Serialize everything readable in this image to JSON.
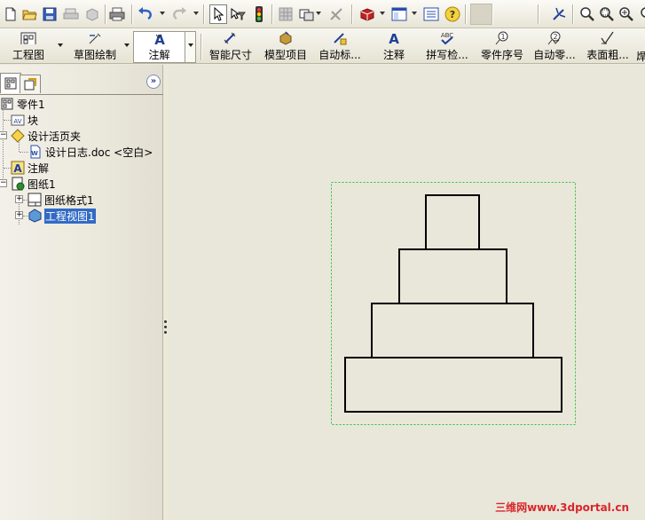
{
  "command_manager": {
    "drawing_label": "工程图",
    "sketch_label": "草图绘制",
    "annotation_label": "注解",
    "items": [
      {
        "label": "智能尺寸"
      },
      {
        "label": "模型项目"
      },
      {
        "label": "自动标..."
      },
      {
        "label": "注释"
      },
      {
        "label": "拼写检..."
      },
      {
        "label": "零件序号"
      },
      {
        "label": "自动零..."
      },
      {
        "label": "表面粗..."
      }
    ],
    "overflow_label": "焊"
  },
  "feature_manager": {
    "collapse_glyph": "»",
    "tree": [
      {
        "label": "零件1"
      },
      {
        "label": "块"
      },
      {
        "label": "设计活页夹"
      },
      {
        "label": "设计日志.doc <空白>"
      },
      {
        "label": "注解"
      },
      {
        "label": "图纸1"
      },
      {
        "label": "图纸格式1"
      },
      {
        "label": "工程视图1"
      }
    ]
  },
  "drawing": {
    "selection_color": "#2ecc40",
    "line_color": "#000000"
  },
  "watermark": {
    "cn": "三维网",
    "url": "www.3dportal.cn"
  },
  "icons": {
    "toolbar": [
      "new-icon",
      "open-icon",
      "save-icon",
      "print-preview-icon",
      "print-icon",
      "undo-icon",
      "redo-icon",
      "select-icon",
      "select-filter-icon",
      "traffic-light-icon",
      "grid-icon",
      "layer-icon",
      "rebuild-icon",
      "material-icon",
      "window-icon",
      "properties-icon",
      "help-icon",
      "zoom-fit-icon",
      "zoom-area-icon",
      "zoom-icon",
      "zoom-all-icon"
    ]
  }
}
